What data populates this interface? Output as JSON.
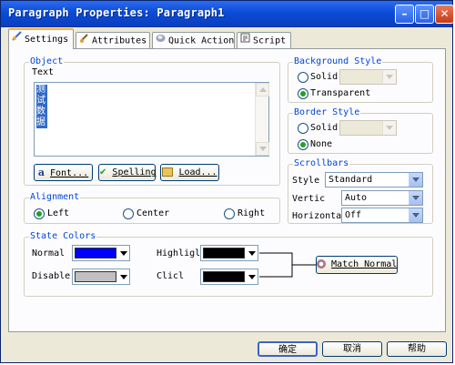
{
  "window": {
    "title": "Paragraph Properties: Paragraph1",
    "controls": {
      "minimize": "–",
      "maximize": "□",
      "close": "✕"
    }
  },
  "tabs": [
    {
      "label": "Settings",
      "icon": "settings-icon",
      "active": true
    },
    {
      "label": "Attributes",
      "icon": "attributes-icon",
      "active": false
    },
    {
      "label": "Quick Action",
      "icon": "quick-action-icon",
      "active": false
    },
    {
      "label": "Script",
      "icon": "script-icon",
      "active": false
    }
  ],
  "object": {
    "legend": "Object",
    "text_label": "Text",
    "text_value": "测\n试\n数\n据",
    "buttons": {
      "font": "Font...",
      "spelling": "Spelling",
      "load": "Load..."
    }
  },
  "alignment": {
    "legend": "Alignment",
    "options": [
      "Left",
      "Center",
      "Right"
    ],
    "selected": "Left"
  },
  "background_style": {
    "legend": "Background Style",
    "solid_label": "Solid",
    "transparent_label": "Transparent",
    "selected": "Transparent"
  },
  "border_style": {
    "legend": "Border Style",
    "solid_label": "Solid",
    "none_label": "None",
    "selected": "None"
  },
  "scrollbars": {
    "legend": "Scrollbars",
    "style_label": "Style",
    "style_value": "Standard",
    "vertical_label": "Vertic",
    "vertical_value": "Auto",
    "horizontal_label": "Horizonta",
    "horizontal_value": "Off"
  },
  "state_colors": {
    "legend": "State Colors",
    "normal_label": "Normal",
    "disabled_label": "Disable",
    "highlight_label": "Highligl",
    "click_label": "Clicl",
    "normal_color": "#0000ff",
    "disabled_color": "#c0c0c0",
    "highlight_color": "#000000",
    "click_color": "#000000",
    "match_button": "Match Normal"
  },
  "footer": {
    "ok": "确定",
    "cancel": "取消",
    "help": "帮助"
  },
  "colors": {
    "title_bar": "#0b4bd6",
    "legend_text": "#0046d5",
    "tab_highlight": "#f6b335"
  }
}
